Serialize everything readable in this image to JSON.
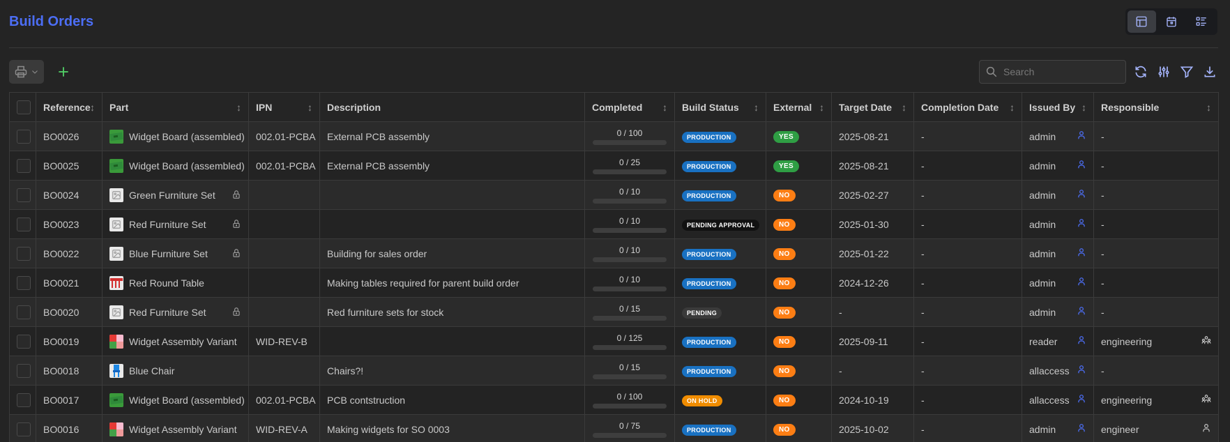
{
  "page": {
    "title": "Build Orders"
  },
  "search": {
    "placeholder": "Search"
  },
  "columns": {
    "reference": "Reference",
    "part": "Part",
    "ipn": "IPN",
    "description": "Description",
    "completed": "Completed",
    "build_status": "Build Status",
    "external": "External",
    "target_date": "Target Date",
    "completion_date": "Completion Date",
    "issued_by": "Issued By",
    "responsible": "Responsible"
  },
  "colors": {
    "accent": "#4c6ef5",
    "production": "#1971c2",
    "yes": "#2f9e44",
    "no": "#fd7e14",
    "on_hold": "#f08c00"
  },
  "rows": [
    {
      "reference": "BO0026",
      "part": "Widget Board (assembled)",
      "thumb": "board",
      "locked": false,
      "ipn": "002.01-PCBA",
      "description": "External PCB assembly",
      "completed": "0 / 100",
      "progress": 0,
      "status": "PRODUCTION",
      "status_kind": "production",
      "external": "YES",
      "target_date": "2025-08-21",
      "completion_date": "-",
      "issued_by": "admin",
      "responsible": "-",
      "responsible_icon": ""
    },
    {
      "reference": "BO0025",
      "part": "Widget Board (assembled)",
      "thumb": "board",
      "locked": false,
      "ipn": "002.01-PCBA",
      "description": "External PCB assembly",
      "completed": "0 / 25",
      "progress": 0,
      "status": "PRODUCTION",
      "status_kind": "production",
      "external": "YES",
      "target_date": "2025-08-21",
      "completion_date": "-",
      "issued_by": "admin",
      "responsible": "-",
      "responsible_icon": ""
    },
    {
      "reference": "BO0024",
      "part": "Green Furniture Set",
      "thumb": "blank",
      "locked": true,
      "ipn": "",
      "description": "",
      "completed": "0 / 10",
      "progress": 0,
      "status": "PRODUCTION",
      "status_kind": "production",
      "external": "NO",
      "target_date": "2025-02-27",
      "completion_date": "-",
      "issued_by": "admin",
      "responsible": "-",
      "responsible_icon": ""
    },
    {
      "reference": "BO0023",
      "part": "Red Furniture Set",
      "thumb": "blank",
      "locked": true,
      "ipn": "",
      "description": "",
      "completed": "0 / 10",
      "progress": 0,
      "status": "PENDING APPROVAL",
      "status_kind": "pending-approval",
      "external": "NO",
      "target_date": "2025-01-30",
      "completion_date": "-",
      "issued_by": "admin",
      "responsible": "-",
      "responsible_icon": ""
    },
    {
      "reference": "BO0022",
      "part": "Blue Furniture Set",
      "thumb": "blank",
      "locked": true,
      "ipn": "",
      "description": "Building for sales order",
      "completed": "0 / 10",
      "progress": 0,
      "status": "PRODUCTION",
      "status_kind": "production",
      "external": "NO",
      "target_date": "2025-01-22",
      "completion_date": "-",
      "issued_by": "admin",
      "responsible": "-",
      "responsible_icon": ""
    },
    {
      "reference": "BO0021",
      "part": "Red Round Table",
      "thumb": "table",
      "locked": false,
      "ipn": "",
      "description": "Making tables required for parent build order",
      "completed": "0 / 10",
      "progress": 0,
      "status": "PRODUCTION",
      "status_kind": "production",
      "external": "NO",
      "target_date": "2024-12-26",
      "completion_date": "-",
      "issued_by": "admin",
      "responsible": "-",
      "responsible_icon": ""
    },
    {
      "reference": "BO0020",
      "part": "Red Furniture Set",
      "thumb": "blank",
      "locked": true,
      "ipn": "",
      "description": "Red furniture sets for stock",
      "completed": "0 / 15",
      "progress": 0,
      "status": "PENDING",
      "status_kind": "pending",
      "external": "NO",
      "target_date": "-",
      "completion_date": "-",
      "issued_by": "admin",
      "responsible": "-",
      "responsible_icon": ""
    },
    {
      "reference": "BO0019",
      "part": "Widget Assembly Variant",
      "thumb": "variant",
      "locked": false,
      "ipn": "WID-REV-B",
      "description": "",
      "completed": "0 / 125",
      "progress": 0,
      "status": "PRODUCTION",
      "status_kind": "production",
      "external": "NO",
      "target_date": "2025-09-11",
      "completion_date": "-",
      "issued_by": "reader",
      "responsible": "engineering",
      "responsible_icon": "group"
    },
    {
      "reference": "BO0018",
      "part": "Blue Chair",
      "thumb": "chair",
      "locked": false,
      "ipn": "",
      "description": "Chairs?!",
      "completed": "0 / 15",
      "progress": 0,
      "status": "PRODUCTION",
      "status_kind": "production",
      "external": "NO",
      "target_date": "-",
      "completion_date": "-",
      "issued_by": "allaccess",
      "responsible": "-",
      "responsible_icon": ""
    },
    {
      "reference": "BO0017",
      "part": "Widget Board (assembled)",
      "thumb": "board",
      "locked": false,
      "ipn": "002.01-PCBA",
      "description": "PCB contstruction",
      "completed": "0 / 100",
      "progress": 0,
      "status": "ON HOLD",
      "status_kind": "on-hold",
      "external": "NO",
      "target_date": "2024-10-19",
      "completion_date": "-",
      "issued_by": "allaccess",
      "responsible": "engineering",
      "responsible_icon": "group"
    },
    {
      "reference": "BO0016",
      "part": "Widget Assembly Variant",
      "thumb": "variant",
      "locked": false,
      "ipn": "WID-REV-A",
      "description": "Making widgets for SO 0003",
      "completed": "0 / 75",
      "progress": 0,
      "status": "PRODUCTION",
      "status_kind": "production",
      "external": "NO",
      "target_date": "2025-10-02",
      "completion_date": "-",
      "issued_by": "admin",
      "responsible": "engineer",
      "responsible_icon": "user"
    }
  ]
}
